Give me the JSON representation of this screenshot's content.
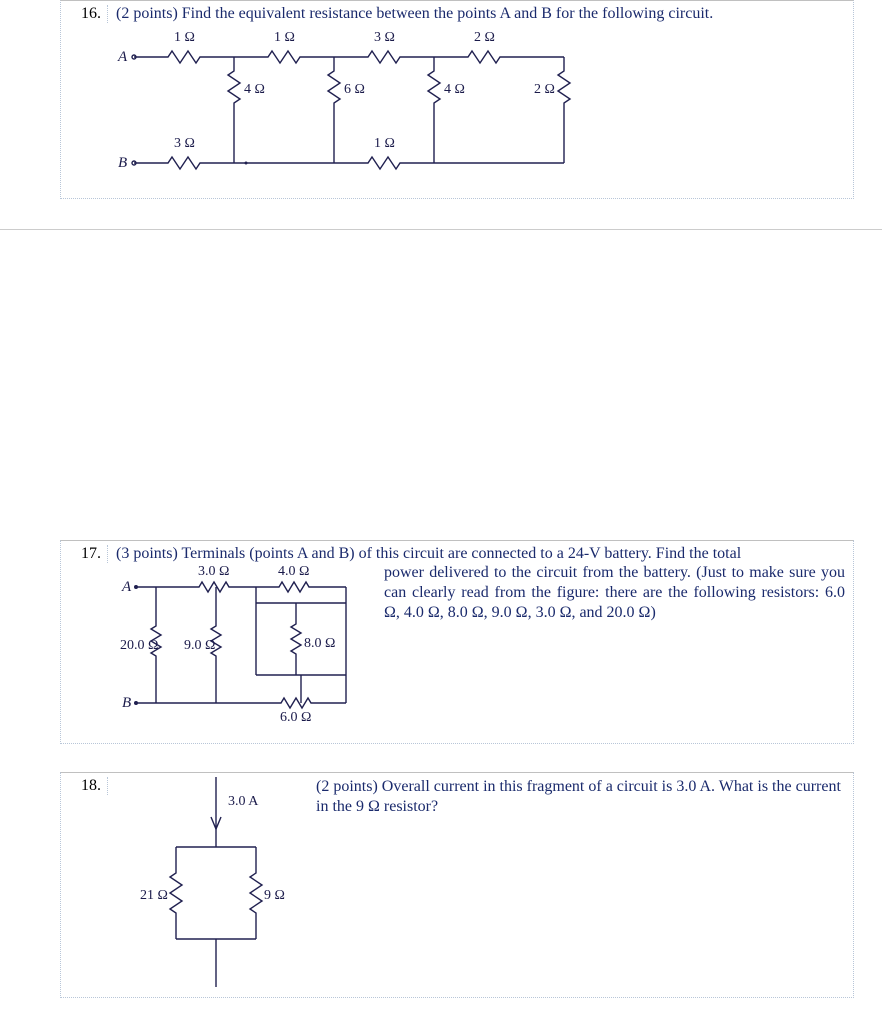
{
  "q16": {
    "number": "16.",
    "points": "(2 points)",
    "prompt": "Find the equivalent resistance between the points A and B for the following circuit.",
    "labels": {
      "A": "A",
      "B": "B",
      "top1": "1 Ω",
      "top2": "1 Ω",
      "top3": "3 Ω",
      "top4": "2 Ω",
      "v1": "4 Ω",
      "v2": "6 Ω",
      "v3": "4 Ω",
      "v4": "2 Ω",
      "bot1": "3 Ω",
      "bot2": "1 Ω"
    }
  },
  "q17": {
    "number": "17.",
    "points": "(3 points)",
    "prompt_part1": "Terminals (points A and B) of this circuit are connected to a 24-V battery. Find the total",
    "prompt_part2": "power delivered to the circuit from the battery. (Just to make sure you can clearly read from the figure: there are the following resistors: 6.0 Ω, 4.0 Ω, 8.0 Ω, 9.0 Ω, 3.0 Ω, and 20.0 Ω)",
    "labels": {
      "A": "A",
      "B": "B",
      "r3": "3.0 Ω",
      "r4": "4.0 Ω",
      "r20": "20.0 Ω",
      "r9": "9.0 Ω",
      "r8": "8.0 Ω",
      "r6": "6.0 Ω"
    }
  },
  "q18": {
    "number": "18.",
    "points": "(2 points)",
    "prompt": "Overall current in this fragment of a circuit is 3.0 A. What is the current in the 9 Ω resistor?",
    "labels": {
      "I": "3.0 A",
      "r21": "21 Ω",
      "r9": "9 Ω"
    }
  }
}
